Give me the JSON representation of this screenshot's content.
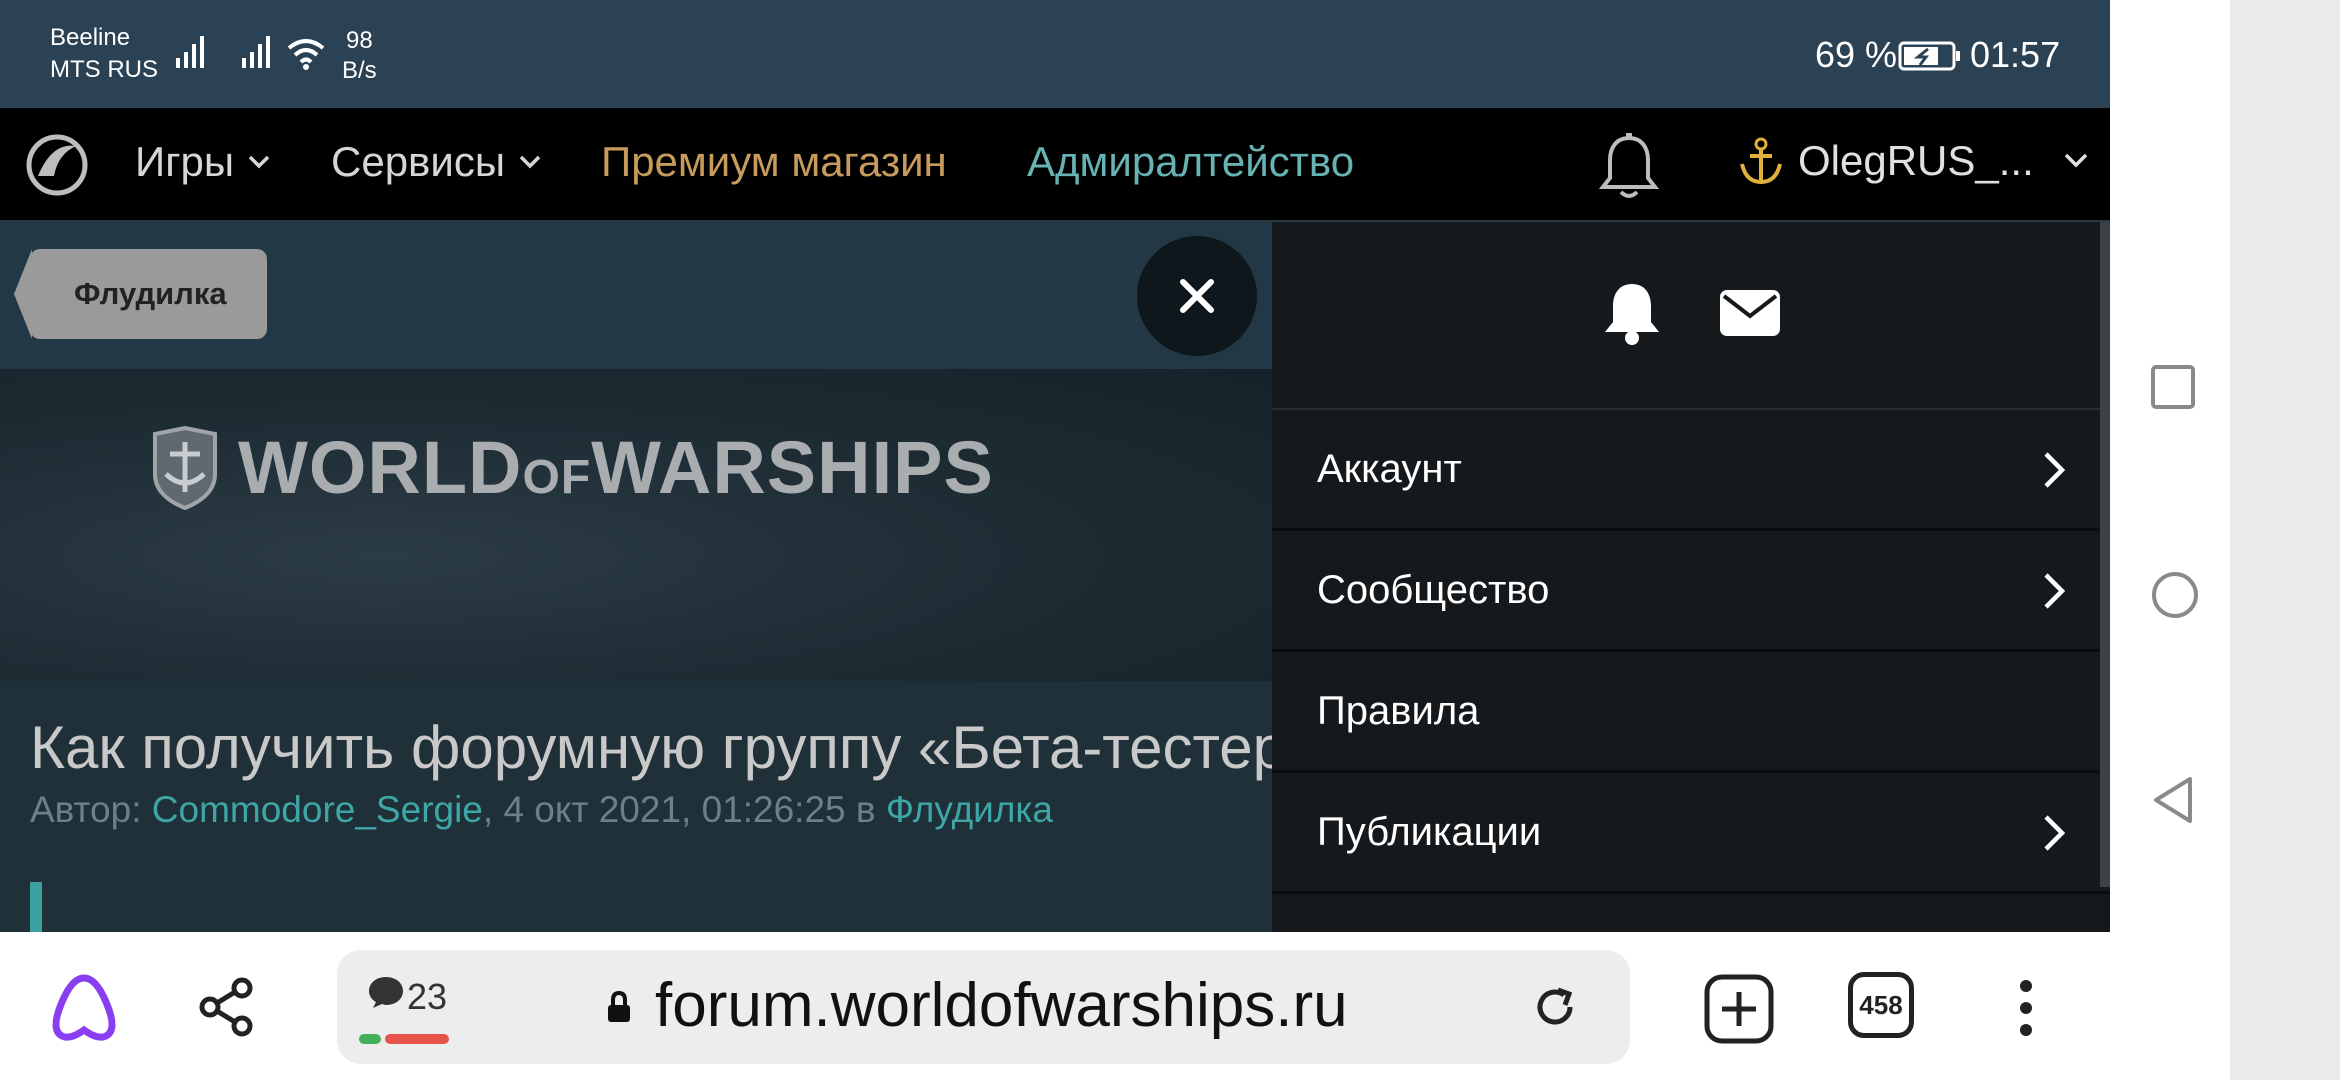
{
  "status_bar": {
    "carrier1": "Beeline",
    "carrier2": "MTS RUS",
    "net_speed_value": "98",
    "net_speed_unit": "B/s",
    "battery": "69 %",
    "time": "01:57"
  },
  "site_nav": {
    "games": "Игры",
    "services": "Сервисы",
    "premium": "Премиум магазин",
    "admiralty": "Адмиралтейство",
    "username": "OlegRUS_..."
  },
  "page": {
    "breadcrumb": "Флудилка",
    "banner_word1": "WORLD",
    "banner_word_of": "OF",
    "banner_word2": "WARSHIPS",
    "topic_title": "Как получить форумную группу «Бета-тестер",
    "meta_prefix": "Автор: ",
    "meta_author": "Commodore_Sergie",
    "meta_date": ", 4 окт 2021, 01:26:25 в ",
    "meta_forum": "Флудилка"
  },
  "drawer": {
    "items": [
      {
        "label": "Аккаунт",
        "has_submenu": true
      },
      {
        "label": "Сообщество",
        "has_submenu": true
      },
      {
        "label": "Правила",
        "has_submenu": false
      },
      {
        "label": "Публикации",
        "has_submenu": true
      }
    ]
  },
  "browser": {
    "comments_count": "23",
    "url": "forum.worldofwarships.ru",
    "tabs_count": "458"
  },
  "colors": {
    "premium": "#c79b5c",
    "admiralty": "#67b2b3",
    "link": "#3ea6a6",
    "alice": "#8a3ef1"
  }
}
